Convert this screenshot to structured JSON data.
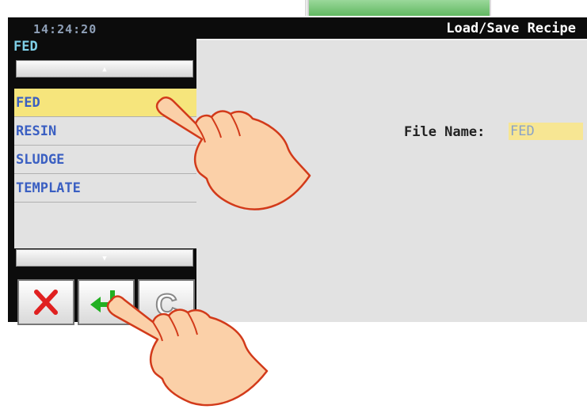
{
  "window": {
    "clock": "14:24:20",
    "title": "Load/Save Recipe"
  },
  "current_file": "FED",
  "scroll": {
    "up_icon": "arrow-up-icon",
    "down_icon": "arrow-down-icon"
  },
  "recipes": [
    {
      "label": "FED",
      "selected": true
    },
    {
      "label": "RESIN",
      "selected": false
    },
    {
      "label": "SLUDGE",
      "selected": false
    },
    {
      "label": "TEMPLATE",
      "selected": false
    }
  ],
  "buttons": {
    "cancel_icon": "close-x-icon",
    "enter_icon": "enter-arrow-icon",
    "clear_label": "C"
  },
  "file_name": {
    "label": "File Name:",
    "value": "FED"
  },
  "colors": {
    "selected_row": "#f6e57c",
    "list_text": "#3a5fc2",
    "cancel": "#e02020",
    "enter": "#22b022"
  }
}
